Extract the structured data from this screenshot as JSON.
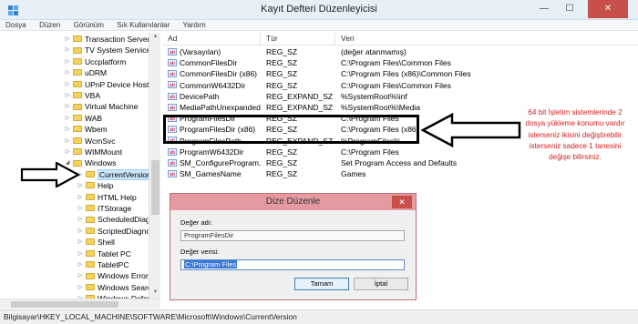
{
  "window": {
    "title": "Kayıt Defteri Düzenleyicisi",
    "minimize_glyph": "—",
    "maximize_glyph": "☐",
    "close_glyph": "✕"
  },
  "menu": [
    "Dosya",
    "Düzen",
    "Görünüm",
    "Sık Kullanılanlar",
    "Yardım"
  ],
  "tree": {
    "items": [
      {
        "label": "Transaction Server",
        "selected": false
      },
      {
        "label": "TV System Services",
        "selected": false
      },
      {
        "label": "Uccplatform",
        "selected": false
      },
      {
        "label": "uDRM",
        "selected": false
      },
      {
        "label": "UPnP Device Host",
        "selected": false
      },
      {
        "label": "VBA",
        "selected": false
      },
      {
        "label": "Virtual Machine",
        "selected": false
      },
      {
        "label": "WAB",
        "selected": false
      },
      {
        "label": "Wbem",
        "selected": false
      },
      {
        "label": "WcmSvc",
        "selected": false
      },
      {
        "label": "WIMMount",
        "selected": false
      },
      {
        "label": "Windows",
        "selected": false
      },
      {
        "label": "CurrentVersion",
        "selected": true
      },
      {
        "label": "Help",
        "selected": false
      },
      {
        "label": "HTML Help",
        "selected": false
      },
      {
        "label": "ITStorage",
        "selected": false
      },
      {
        "label": "ScheduledDiagno",
        "selected": false
      },
      {
        "label": "ScriptedDiagnosti",
        "selected": false
      },
      {
        "label": "Shell",
        "selected": false
      },
      {
        "label": "Tablet PC",
        "selected": false
      },
      {
        "label": "TabletPC",
        "selected": false
      },
      {
        "label": "Windows Error Re",
        "selected": false
      },
      {
        "label": "Windows Search",
        "selected": false
      },
      {
        "label": "Windows Defender",
        "selected": false
      }
    ]
  },
  "list": {
    "columns": [
      "Ad",
      "Tür",
      "Veri"
    ],
    "rows": [
      {
        "name": "(Varsayılan)",
        "type": "REG_SZ",
        "data": "(değer atanmamış)",
        "icon": "string-value-icon"
      },
      {
        "name": "CommonFilesDir",
        "type": "REG_SZ",
        "data": "C:\\Program Files\\Common Files",
        "icon": "string-value-icon"
      },
      {
        "name": "CommonFilesDir (x86)",
        "type": "REG_SZ",
        "data": "C:\\Program Files (x86)\\Common Files",
        "icon": "string-value-icon"
      },
      {
        "name": "CommonW6432Dir",
        "type": "REG_SZ",
        "data": "C:\\Program Files\\Common Files",
        "icon": "string-value-icon"
      },
      {
        "name": "DevicePath",
        "type": "REG_EXPAND_SZ",
        "data": "%SystemRoot%\\inf",
        "icon": "string-value-icon"
      },
      {
        "name": "MediaPathUnexpanded",
        "type": "REG_EXPAND_SZ",
        "data": "%SystemRoot%\\Media",
        "icon": "string-value-icon"
      },
      {
        "name": "ProgramFilesDir",
        "type": "REG_SZ",
        "data": "C:\\Program Files",
        "icon": "string-value-icon"
      },
      {
        "name": "ProgramFilesDir (x86)",
        "type": "REG_SZ",
        "data": "C:\\Program Files (x86)",
        "icon": "string-value-icon"
      },
      {
        "name": "ProgramFilesPath",
        "type": "REG_EXPAND_SZ",
        "data": "%ProgramFiles%",
        "icon": "string-value-icon"
      },
      {
        "name": "ProgramW6432Dir",
        "type": "REG_SZ",
        "data": "C:\\Program Files",
        "icon": "string-value-icon"
      },
      {
        "name": "SM_ConfigureProgram...",
        "type": "REG_SZ",
        "data": "Set Program Access and Defaults",
        "icon": "string-value-icon"
      },
      {
        "name": "SM_GamesName",
        "type": "REG_SZ",
        "data": "Games",
        "icon": "string-value-icon"
      }
    ]
  },
  "dialog": {
    "title": "Dize Düzenle",
    "close_glyph": "✕",
    "name_label": "Değer adı:",
    "name_value": "ProgramFilesDir",
    "data_label": "Değer verisi:",
    "data_value": "C:\\Program Files",
    "ok_label": "Tamam",
    "cancel_label": "İptal"
  },
  "note": {
    "text": "64 bit İşletim sistemlerinde 2 dosya yükleme konumu vardır isterseniz ikisini değiştirebilir isterseniz sadece 1 tanesini değişe bilirsiniz.",
    "color": "#d42020"
  },
  "statusbar": {
    "path": "Bilgisayar\\HKEY_LOCAL_MACHINE\\SOFTWARE\\Microsoft\\Windows\\CurrentVersion"
  }
}
